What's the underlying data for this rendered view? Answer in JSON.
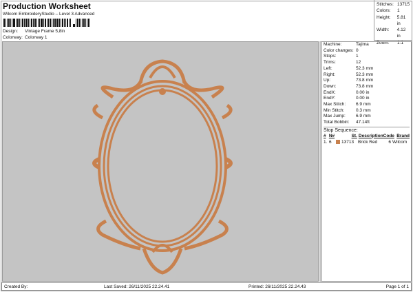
{
  "header": {
    "title": "Production Worksheet",
    "subtitle": "Wilcom EmbroideryStudio – Level 3 Advanced",
    "design_label": "Design:",
    "design": "Vintage Frame 5,8in",
    "colorway_label": "Colorway:",
    "colorway": "Colorway 1"
  },
  "summary": [
    {
      "k": "Stitches:",
      "v": "13715"
    },
    {
      "k": "Colors:",
      "v": "1"
    },
    {
      "k": "Height:",
      "v": "5.81 in"
    },
    {
      "k": "Width:",
      "v": "4.12 in"
    },
    {
      "k": "Zoom:",
      "v": "1:1"
    }
  ],
  "details": [
    {
      "k": "Machine:",
      "v": "Tajima"
    },
    {
      "k": "Color changes:",
      "v": "0"
    },
    {
      "k": "Stops:",
      "v": "1"
    },
    {
      "k": "Trims:",
      "v": "12"
    },
    {
      "k": "Left:",
      "v": "52.3 mm"
    },
    {
      "k": "Right:",
      "v": "52.3 mm"
    },
    {
      "k": "Up:",
      "v": "73.8 mm"
    },
    {
      "k": "Down:",
      "v": "73.8 mm"
    },
    {
      "k": "EndX:",
      "v": "0.00 in"
    },
    {
      "k": "EndY:",
      "v": "0.00 in"
    },
    {
      "k": "Max Stitch:",
      "v": "6.9 mm"
    },
    {
      "k": "Min Stitch:",
      "v": "0.3 mm"
    },
    {
      "k": "Max Jump:",
      "v": "6.9 mm"
    },
    {
      "k": "Total Bobbin:",
      "v": "47.14ft"
    }
  ],
  "stops": {
    "title": "Stop Sequence:",
    "headers": [
      "#",
      "N#",
      "St.",
      "Description",
      "Code",
      "Brand"
    ],
    "rows": [
      {
        "num": "1.",
        "n": "6",
        "st": "13713",
        "desc": "Brick Red",
        "code": "6",
        "brand": "Wilcom",
        "color": "#c8814e"
      }
    ]
  },
  "footer": {
    "created": "Created By:",
    "saved": "Last Saved: 26/11/2025 22.24.41",
    "printed": "Printed: 26/11/2025 22.24.43",
    "page": "Page 1 of 1"
  },
  "colors": {
    "thread": "#c8814e",
    "canvas": "#c4c4c4"
  }
}
